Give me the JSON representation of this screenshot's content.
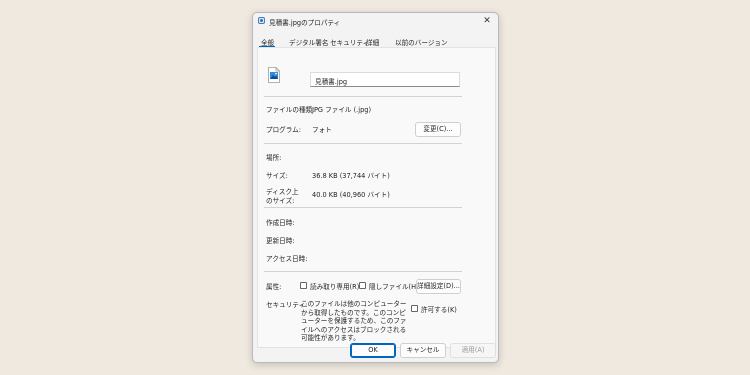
{
  "dialog": {
    "title": "見積書.jpgのプロパティ",
    "close_glyph": "✕"
  },
  "tabs": [
    {
      "label": "全般"
    },
    {
      "label": "デジタル署名"
    },
    {
      "label": "セキュリティ"
    },
    {
      "label": "詳細"
    },
    {
      "label": "以前のバージョン"
    }
  ],
  "general": {
    "file_name": "見積書.jpg",
    "file_type_label": "ファイルの種類:",
    "file_type_value": "JPG ファイル (.jpg)",
    "program_label": "プログラム:",
    "program_value": "フォト",
    "change_button": "変更(C)...",
    "location_label": "場所:",
    "size_label": "サイズ:",
    "size_value": "36.8 KB (37,744 バイト)",
    "disk_size_label_1": "ディスク上",
    "disk_size_label_2": "のサイズ:",
    "disk_size_value": "40.0 KB (40,960 バイト)",
    "created_label": "作成日時:",
    "modified_label": "更新日時:",
    "accessed_label": "アクセス日時:",
    "attributes_label": "属性:",
    "readonly_label": "読み取り専用(R)",
    "hidden_label": "隠しファイル(H)",
    "advanced_button": "詳細設定(D)...",
    "security_label": "セキュリティ:",
    "security_text": "このファイルは他のコンピューターから取得したものです。このコンピューターを保護するため、このファイルへのアクセスはブロックされる可能性があります。",
    "allow_label": "許可する(K)"
  },
  "footer": {
    "ok": "OK",
    "cancel": "キャンセル",
    "apply": "適用(A)"
  },
  "colors": {
    "accent": "#0067c0",
    "tab_underline": "#0067c0",
    "disabled_text": "#9a9a9a"
  },
  "icons": {
    "file": "image-file-icon",
    "title": "properties-icon",
    "close": "close-icon"
  }
}
